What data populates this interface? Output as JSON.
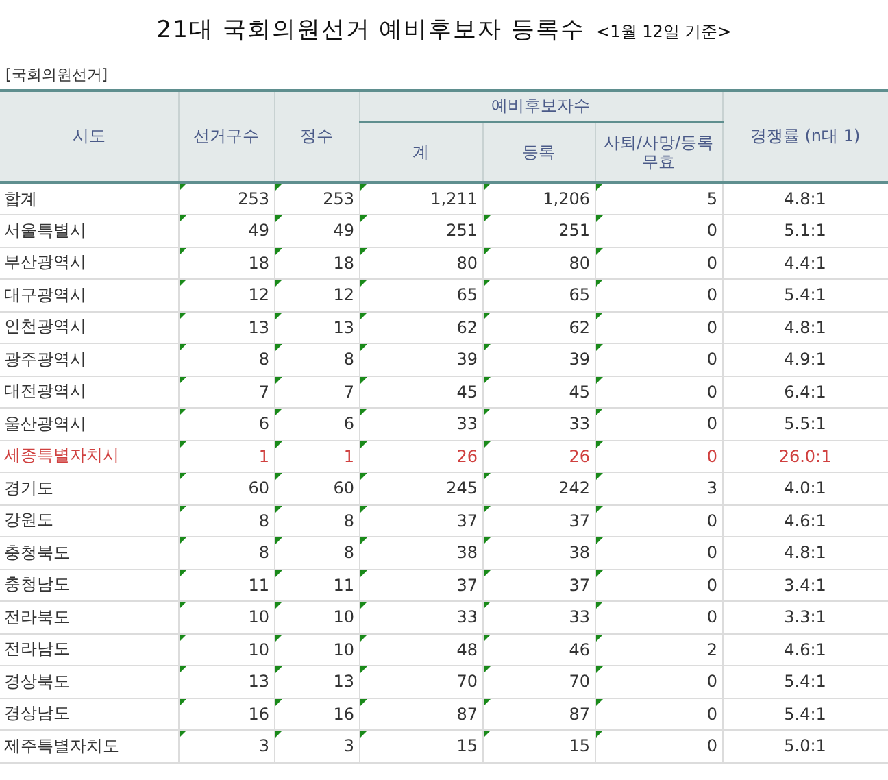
{
  "title": {
    "main": "21대 국회의원선거 예비후보자 등록수",
    "note": "<1월 12일 기준>"
  },
  "subtitle": "[국회의원선거]",
  "table": {
    "columns": {
      "region": "시도",
      "districts": "선거구수",
      "seats": "정수",
      "group": "예비후보자수",
      "total": "계",
      "registered": "등록",
      "withdrawn": "사퇴/사망/등록무효",
      "ratio": "경쟁률 (n대 1)"
    },
    "rows": [
      {
        "cells": [
          "합계",
          "253",
          "253",
          "1,211",
          "1,206",
          "5",
          "4.8:1"
        ],
        "highlighted": false
      },
      {
        "cells": [
          "서울특별시",
          "49",
          "49",
          "251",
          "251",
          "0",
          "5.1:1"
        ],
        "highlighted": false
      },
      {
        "cells": [
          "부산광역시",
          "18",
          "18",
          "80",
          "80",
          "0",
          "4.4:1"
        ],
        "highlighted": false
      },
      {
        "cells": [
          "대구광역시",
          "12",
          "12",
          "65",
          "65",
          "0",
          "5.4:1"
        ],
        "highlighted": false
      },
      {
        "cells": [
          "인천광역시",
          "13",
          "13",
          "62",
          "62",
          "0",
          "4.8:1"
        ],
        "highlighted": false
      },
      {
        "cells": [
          "광주광역시",
          "8",
          "8",
          "39",
          "39",
          "0",
          "4.9:1"
        ],
        "highlighted": false
      },
      {
        "cells": [
          "대전광역시",
          "7",
          "7",
          "45",
          "45",
          "0",
          "6.4:1"
        ],
        "highlighted": false
      },
      {
        "cells": [
          "울산광역시",
          "6",
          "6",
          "33",
          "33",
          "0",
          "5.5:1"
        ],
        "highlighted": false
      },
      {
        "cells": [
          "세종특별자치시",
          "1",
          "1",
          "26",
          "26",
          "0",
          "26.0:1"
        ],
        "highlighted": true
      },
      {
        "cells": [
          "경기도",
          "60",
          "60",
          "245",
          "242",
          "3",
          "4.0:1"
        ],
        "highlighted": false
      },
      {
        "cells": [
          "강원도",
          "8",
          "8",
          "37",
          "37",
          "0",
          "4.6:1"
        ],
        "highlighted": false
      },
      {
        "cells": [
          "충청북도",
          "8",
          "8",
          "38",
          "38",
          "0",
          "4.8:1"
        ],
        "highlighted": false
      },
      {
        "cells": [
          "충청남도",
          "11",
          "11",
          "37",
          "37",
          "0",
          "3.4:1"
        ],
        "highlighted": false
      },
      {
        "cells": [
          "전라북도",
          "10",
          "10",
          "33",
          "33",
          "0",
          "3.3:1"
        ],
        "highlighted": false
      },
      {
        "cells": [
          "전라남도",
          "10",
          "10",
          "48",
          "46",
          "2",
          "4.6:1"
        ],
        "highlighted": false
      },
      {
        "cells": [
          "경상북도",
          "13",
          "13",
          "70",
          "70",
          "0",
          "5.4:1"
        ],
        "highlighted": false
      },
      {
        "cells": [
          "경상남도",
          "16",
          "16",
          "87",
          "87",
          "0",
          "5.4:1"
        ],
        "highlighted": false
      },
      {
        "cells": [
          "제주특별자치도",
          "3",
          "3",
          "15",
          "15",
          "0",
          "5.0:1"
        ],
        "highlighted": false
      }
    ]
  }
}
